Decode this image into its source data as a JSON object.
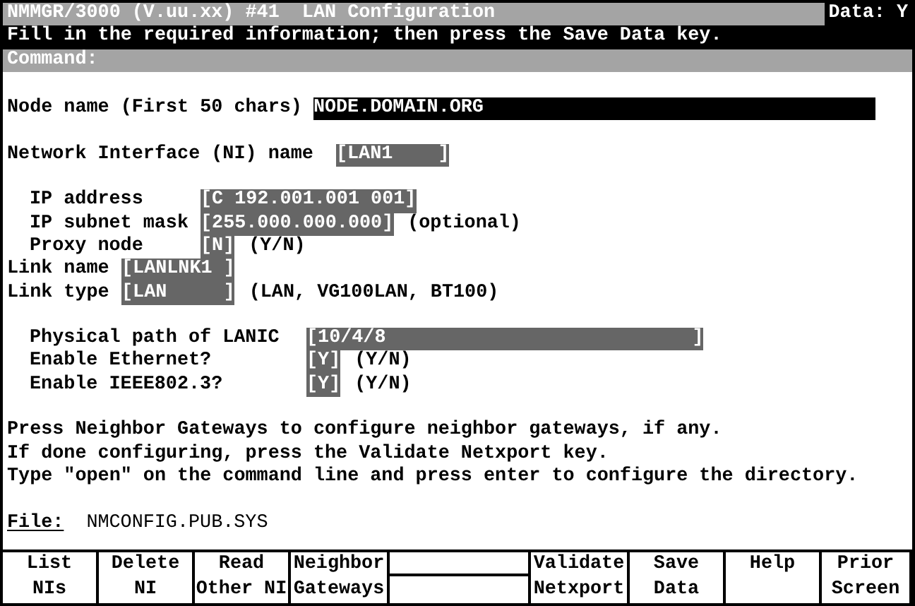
{
  "header": {
    "title": "NMMGR/3000 (V.uu.xx) #41  LAN Configuration",
    "data_flag": "Data: Y",
    "message": "Fill in the required information; then press the Save Data key.",
    "command_label": "Command:"
  },
  "node_name": {
    "label": "Node name (First 50 chars)",
    "value": "NODE.DOMAIN.ORG"
  },
  "ni_name": {
    "label": "Network Interface (NI) name",
    "value": "[LAN1    ]"
  },
  "ip_fields": [
    {
      "label": "IP address",
      "value": "[C 192.001.001 001]"
    },
    {
      "label": "IP subnet mask",
      "value": "[255.000.000.000]",
      "hint": "(optional)"
    },
    {
      "label": "Proxy node",
      "value": "[N]",
      "hint": "(Y/N)"
    }
  ],
  "link_fields": [
    {
      "label": "Link name",
      "value": "[LANLNK1 ]"
    },
    {
      "label": "Link type",
      "value": "[LAN     ]",
      "hint": "(LAN, VG100LAN, BT100)"
    }
  ],
  "lanic_fields": [
    {
      "label": "Physical path of LANIC",
      "value": "[10/4/8                           ]"
    },
    {
      "label": "Enable Ethernet?",
      "value": "[Y]",
      "hint": "(Y/N)"
    },
    {
      "label": "Enable IEEE802.3?",
      "value": "[Y]",
      "hint": "(Y/N)"
    }
  ],
  "instructions": [
    "Press Neighbor Gateways to configure neighbor gateways, if any.",
    "If done configuring, press the Validate Netxport key.",
    "Type \"open\" on the command line and press enter to configure the directory."
  ],
  "file": {
    "label": "File:",
    "value": "NMCONFIG.PUB.SYS"
  },
  "softkeys": [
    {
      "kind": "key",
      "lines": [
        "List",
        "NIs"
      ]
    },
    {
      "kind": "key",
      "lines": [
        "Delete",
        "NI"
      ]
    },
    {
      "kind": "key",
      "lines": [
        "Read",
        "Other NI"
      ]
    },
    {
      "kind": "key",
      "lines": [
        "Neighbor",
        "Gateways"
      ]
    },
    {
      "kind": "blank"
    },
    {
      "kind": "key",
      "lines": [
        "Validate",
        "Netxport"
      ]
    },
    {
      "kind": "key",
      "lines": [
        "Save",
        "Data"
      ]
    },
    {
      "kind": "key",
      "lines": [
        "Help"
      ]
    },
    {
      "kind": "key",
      "lines": [
        "Prior",
        "Screen"
      ]
    }
  ]
}
